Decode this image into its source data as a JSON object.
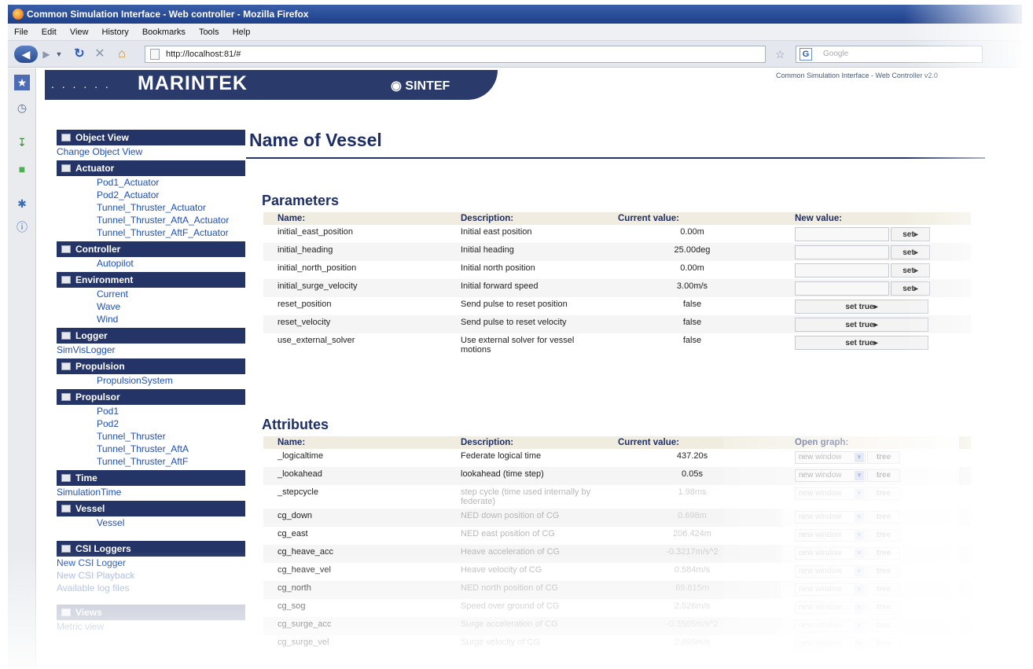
{
  "window": {
    "title": "Common Simulation Interface - Web controller - Mozilla Firefox"
  },
  "menu": [
    "File",
    "Edit",
    "View",
    "History",
    "Bookmarks",
    "Tools",
    "Help"
  ],
  "address": {
    "url": "http://localhost:81/#",
    "search_placeholder": "Google"
  },
  "header": {
    "logo": "MARINTEK",
    "dots": ". . . . . .",
    "partner": "SINTEF",
    "app_name": "Common Simulation Interface - Web Controller v2.0"
  },
  "sidebar": {
    "sections": [
      {
        "title": "Object View",
        "links": [
          {
            "label": "Change Object View",
            "indent": false
          }
        ]
      },
      {
        "title": "Actuator",
        "links": [
          {
            "label": "Pod1_Actuator",
            "indent": true
          },
          {
            "label": "Pod2_Actuator",
            "indent": true
          },
          {
            "label": "Tunnel_Thruster_Actuator",
            "indent": true
          },
          {
            "label": "Tunnel_Thruster_AftA_Actuator",
            "indent": true
          },
          {
            "label": "Tunnel_Thruster_AftF_Actuator",
            "indent": true
          }
        ]
      },
      {
        "title": "Controller",
        "links": [
          {
            "label": "Autopilot",
            "indent": true
          }
        ]
      },
      {
        "title": "Environment",
        "links": [
          {
            "label": "Current",
            "indent": true
          },
          {
            "label": "Wave",
            "indent": true
          },
          {
            "label": "Wind",
            "indent": true
          }
        ]
      },
      {
        "title": "Logger",
        "links": [
          {
            "label": "SimVisLogger",
            "indent": false
          }
        ]
      },
      {
        "title": "Propulsion",
        "links": [
          {
            "label": "PropulsionSystem",
            "indent": true
          }
        ]
      },
      {
        "title": "Propulsor",
        "links": [
          {
            "label": "Pod1",
            "indent": true
          },
          {
            "label": "Pod2",
            "indent": true
          },
          {
            "label": "Tunnel_Thruster",
            "indent": true
          },
          {
            "label": "Tunnel_Thruster_AftA",
            "indent": true
          },
          {
            "label": "Tunnel_Thruster_AftF",
            "indent": true
          }
        ]
      },
      {
        "title": "Time",
        "links": [
          {
            "label": "SimulationTime",
            "indent": false
          }
        ]
      },
      {
        "title": "Vessel",
        "links": [
          {
            "label": "Vessel",
            "indent": true
          }
        ]
      }
    ],
    "loggers": {
      "title": "CSI Loggers",
      "links": [
        "New CSI Logger",
        "New CSI Playback",
        "Available log files"
      ]
    },
    "views": {
      "title": "Views",
      "links": [
        "Metric view"
      ]
    }
  },
  "main": {
    "title": "Name of Vessel",
    "parameters": {
      "title": "Parameters",
      "headers": [
        "Name:",
        "Description:",
        "Current value:",
        "New value:"
      ],
      "rows": [
        {
          "name": "initial_east_position",
          "desc": "Initial east position",
          "value": "0.00m",
          "control": "set",
          "btn": "set▸"
        },
        {
          "name": "initial_heading",
          "desc": "Initial heading",
          "value": "25.00deg",
          "control": "set",
          "btn": "set▸"
        },
        {
          "name": "initial_north_position",
          "desc": "Initial north position",
          "value": "0.00m",
          "control": "set",
          "btn": "set▸"
        },
        {
          "name": "initial_surge_velocity",
          "desc": "Initial forward speed",
          "value": "3.00m/s",
          "control": "set",
          "btn": "set▸"
        },
        {
          "name": "reset_position",
          "desc": "Send pulse to reset position",
          "value": "false",
          "control": "settrue",
          "btn": "set true▸"
        },
        {
          "name": "reset_velocity",
          "desc": "Send pulse to reset velocity",
          "value": "false",
          "control": "settrue",
          "btn": "set true▸"
        },
        {
          "name": "use_external_solver",
          "desc": "Use external solver for vessel motions",
          "value": "false",
          "control": "settrue",
          "btn": "set true▸"
        }
      ]
    },
    "attributes": {
      "title": "Attributes",
      "headers": [
        "Name:",
        "Description:",
        "Current value:",
        "Open graph:"
      ],
      "select_label": "new window",
      "tree_label": "tree",
      "rows": [
        {
          "name": "_logicaltime",
          "desc": "Federate logical time",
          "value": "437.20s"
        },
        {
          "name": "_lookahead",
          "desc": "lookahead (time step)",
          "value": "0.05s"
        },
        {
          "name": "_stepcycle",
          "desc": "step cycle (time used internally by federate)",
          "value": "1.98ms"
        },
        {
          "name": "cg_down",
          "desc": "NED down position of CG",
          "value": "0.698m"
        },
        {
          "name": "cg_east",
          "desc": "NED east position of CG",
          "value": "206.424m"
        },
        {
          "name": "cg_heave_acc",
          "desc": "Heave acceleration of CG",
          "value": "-0.3217m/s^2"
        },
        {
          "name": "cg_heave_vel",
          "desc": "Heave velocity of CG",
          "value": "0.584m/s"
        },
        {
          "name": "cg_north",
          "desc": "NED north position of CG",
          "value": "69.815m"
        },
        {
          "name": "cg_sog",
          "desc": "Speed over ground of CG",
          "value": "2.526m/s"
        },
        {
          "name": "cg_surge_acc",
          "desc": "Surge acceleration of CG",
          "value": "-0.3585m/s^2"
        },
        {
          "name": "cg_surge_vel",
          "desc": "Surge velocity of CG",
          "value": "2.895m/s"
        }
      ]
    }
  }
}
